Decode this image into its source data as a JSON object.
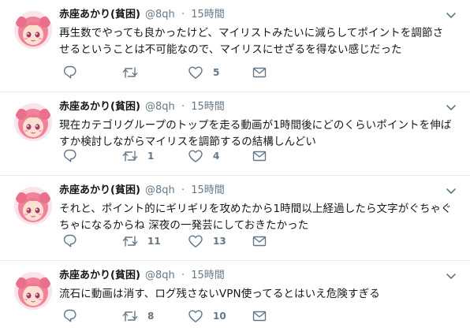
{
  "user": {
    "name": "赤座あかり(貧困)",
    "handle": "@8qh",
    "separator": "·"
  },
  "icons": {
    "reply": "reply-icon",
    "retweet": "retweet-icon",
    "like": "heart-icon",
    "dm": "envelope-icon",
    "menu": "chevron-down-icon"
  },
  "colors": {
    "icon": "#657786",
    "divider": "#e6ecf0"
  },
  "tweets": [
    {
      "time": "15時間",
      "text": "再生数でやっても良かったけど、マイリストみたいに減らしてポイントを調節させるということは不可能なので、マイリスにせざるを得ない感じだった",
      "retweets": "",
      "likes": "5"
    },
    {
      "time": "15時間",
      "text": "現在カテゴリグループのトップを走る動画が1時間後にどのくらいポイントを伸ばすか検討しながらマイリスを調節するの結構しんどい",
      "retweets": "1",
      "likes": "4"
    },
    {
      "time": "15時間",
      "text": "それと、ポイント的にギリギリを攻めたから1時間以上経過したら文字がぐちゃぐちゃになるからね 深夜の一発芸にしておきたかった",
      "retweets": "11",
      "likes": "13"
    },
    {
      "time": "15時間",
      "text": "流石に動画は消す、ログ残さないVPN使ってるとはいえ危険すぎる",
      "retweets": "8",
      "likes": "10"
    }
  ]
}
